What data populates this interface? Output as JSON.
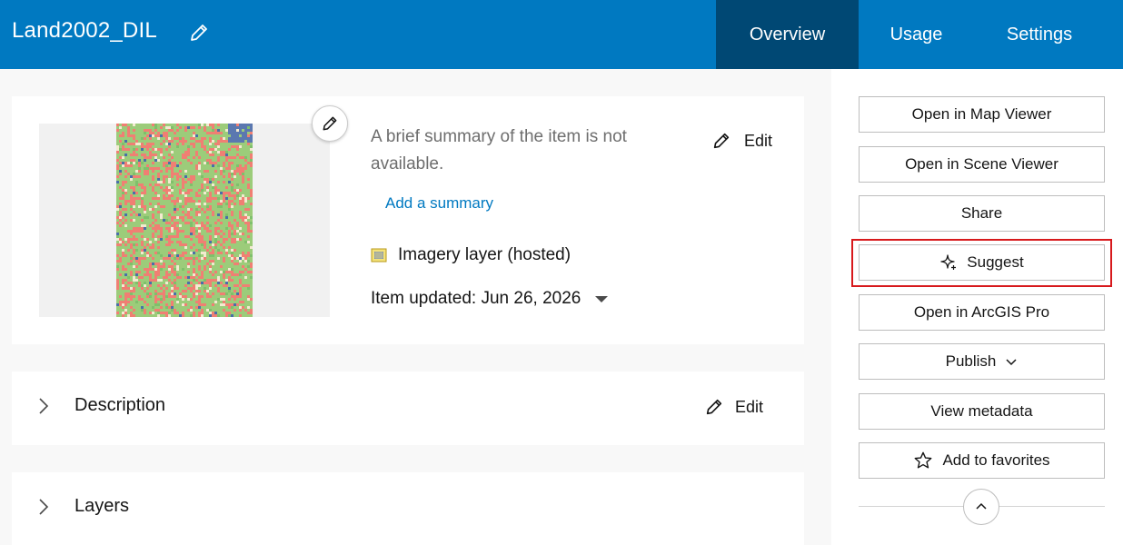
{
  "header": {
    "title": "Land2002_DIL",
    "tabs": [
      {
        "label": "Overview",
        "active": true
      },
      {
        "label": "Usage",
        "active": false
      },
      {
        "label": "Settings",
        "active": false
      }
    ]
  },
  "summary": {
    "text": "A brief summary of the item is not available.",
    "edit_label": "Edit",
    "add_summary_label": "Add a summary",
    "item_type": "Imagery layer (hosted)",
    "updated_label": "Item updated: Jun 26, 2026"
  },
  "sections": {
    "description": {
      "label": "Description",
      "edit_label": "Edit"
    },
    "layers": {
      "label": "Layers"
    }
  },
  "sidebar": {
    "open_map_viewer": "Open in Map Viewer",
    "open_scene_viewer": "Open in Scene Viewer",
    "share": "Share",
    "suggest": "Suggest",
    "open_arcgis_pro": "Open in ArcGIS Pro",
    "publish": "Publish",
    "view_metadata": "View metadata",
    "add_favorites": "Add to favorites"
  },
  "colors": {
    "header": "#0079c1",
    "active_tab": "#004874",
    "link": "#0079c1",
    "highlight": "#d7191c"
  }
}
